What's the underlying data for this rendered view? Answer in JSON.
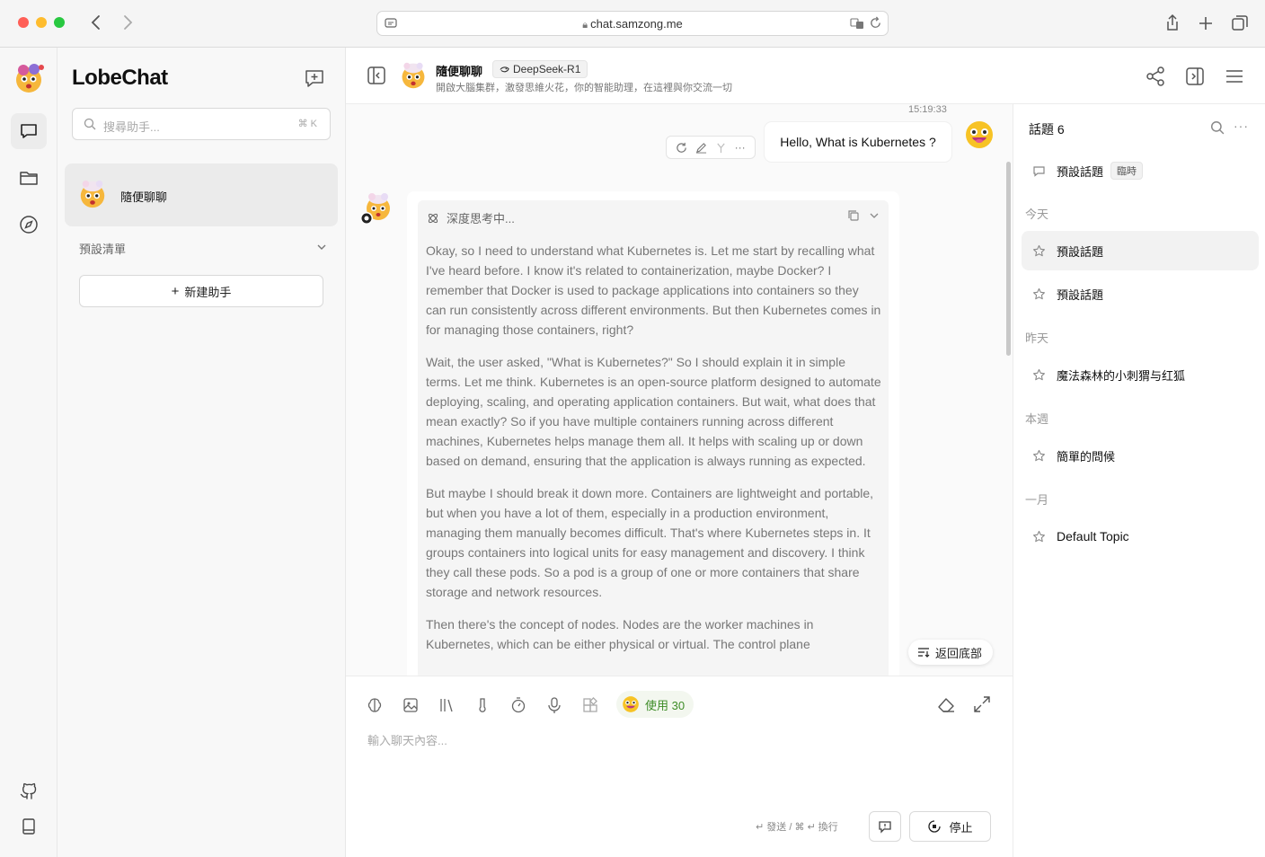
{
  "browser": {
    "url": "chat.samzong.me"
  },
  "sidebar": {
    "brand": "LobeChat",
    "search_placeholder": "搜尋助手...",
    "search_shortcut": "⌘ K",
    "session_name": "隨便聊聊",
    "group_label": "預設清單",
    "new_assistant_label": "新建助手"
  },
  "chat_header": {
    "name": "隨便聊聊",
    "model": "DeepSeek-R1",
    "description": "開啟大腦集群，激發思維火花，你的智能助理，在這裡與你交流一切"
  },
  "messages": {
    "timestamp": "15:19:33",
    "user_text": "Hello, What is Kubernetes ?",
    "thinking_label": "深度思考中...",
    "thinking_paragraphs": [
      "Okay, so I need to understand what Kubernetes is. Let me start by recalling what I've heard before. I know it's related to containerization, maybe Docker? I remember that Docker is used to package applications into containers so they can run consistently across different environments. But then Kubernetes comes in for managing those containers, right?",
      "Wait, the user asked, \"What is Kubernetes?\" So I should explain it in simple terms. Let me think. Kubernetes is an open-source platform designed to automate deploying, scaling, and operating application containers. But wait, what does that mean exactly? So if you have multiple containers running across different machines, Kubernetes helps manage them all. It helps with scaling up or down based on demand, ensuring that the application is always running as expected.",
      "But maybe I should break it down more. Containers are lightweight and portable, but when you have a lot of them, especially in a production environment, managing them manually becomes difficult. That's where Kubernetes steps in. It groups containers into logical units for easy management and discovery. I think they call these pods. So a pod is a group of one or more containers that share storage and network resources.",
      "Then there's the concept of nodes. Nodes are the worker machines in Kubernetes, which can be either physical or virtual. The control plane"
    ],
    "back_to_bottom": "返回底部"
  },
  "input": {
    "usage_label": "使用 30",
    "placeholder": "輸入聊天內容...",
    "send_hint": "↵ 發送 / ⌘ ↵ 換行",
    "stop_label": "停止"
  },
  "topics": {
    "header": "話題 6",
    "pinned": {
      "label": "預設話題",
      "tag": "臨時"
    },
    "groups": [
      {
        "label": "今天",
        "items": [
          "預設話題",
          "預設話題"
        ]
      },
      {
        "label": "昨天",
        "items": [
          "魔法森林的小刺猬与红狐"
        ]
      },
      {
        "label": "本週",
        "items": [
          "簡單的問候"
        ]
      },
      {
        "label": "一月",
        "items": [
          "Default Topic"
        ]
      }
    ]
  },
  "colors": {
    "accent_green": "#3d8c26",
    "selected_bg": "#ebebeb"
  }
}
